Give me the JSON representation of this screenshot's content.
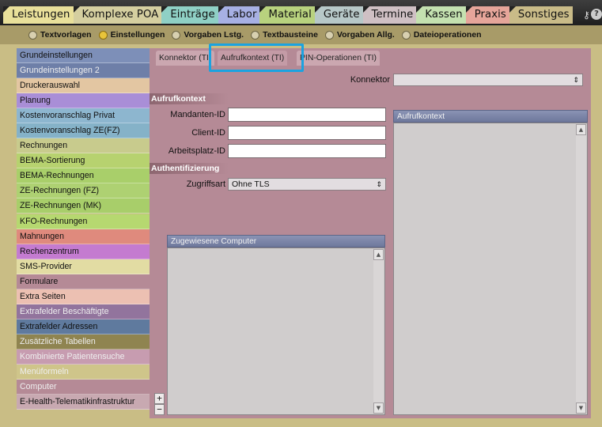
{
  "menu": {
    "items": [
      {
        "label": "Leistungen",
        "bg": "#e9e09a"
      },
      {
        "label": "Komplexe POA",
        "bg": "#d5cfa0"
      },
      {
        "label": "Einträge",
        "bg": "#8fd0c5"
      },
      {
        "label": "Labor",
        "bg": "#a7b0e4"
      },
      {
        "label": "Material",
        "bg": "#b8d27e"
      },
      {
        "label": "Geräte",
        "bg": "#b7c8c8"
      },
      {
        "label": "Termine",
        "bg": "#cfc0c4"
      },
      {
        "label": "Kassen",
        "bg": "#c4e1b0"
      },
      {
        "label": "Praxis",
        "bg": "#e6a59a"
      },
      {
        "label": "Sonstiges",
        "bg": "#c9bb88"
      }
    ],
    "tools": {
      "key_icon": "key-icon",
      "help_icon": "help-icon",
      "help_symbol": "?"
    }
  },
  "subbar": {
    "options": [
      {
        "label": "Textvorlagen",
        "selected": true
      },
      {
        "label": "Einstellungen",
        "selected": false,
        "radio_on": true
      },
      {
        "label": "Vorgaben Lstg.",
        "selected": false
      },
      {
        "label": "Textbausteine",
        "selected": false
      },
      {
        "label": "Vorgaben Allg.",
        "selected": false
      },
      {
        "label": "Dateioperationen",
        "selected": false
      }
    ]
  },
  "nav": {
    "items": [
      {
        "label": "Grundeinstellungen",
        "bg": "#7d8fb8",
        "light": false
      },
      {
        "label": "Grundeinstellungen 2",
        "bg": "#6e7fa8",
        "light": true
      },
      {
        "label": "Druckerauswahl",
        "bg": "#e3c6a2",
        "light": false
      },
      {
        "label": "Planung",
        "bg": "#a98ed7",
        "light": false
      },
      {
        "label": "Kostenvoranschlag Privat",
        "bg": "#8db6cf",
        "light": false
      },
      {
        "label": "Kostenvoranschlag ZE(FZ)",
        "bg": "#85b2c8",
        "light": false
      },
      {
        "label": "Rechnungen",
        "bg": "#c8cb8d",
        "light": false
      },
      {
        "label": "BEMA-Sortierung",
        "bg": "#b7d26f",
        "light": false
      },
      {
        "label": "BEMA-Rechnungen",
        "bg": "#a9cf6a",
        "light": false
      },
      {
        "label": "ZE-Rechnungen (FZ)",
        "bg": "#aed172",
        "light": false
      },
      {
        "label": "ZE-Rechnungen (MK)",
        "bg": "#a8ce6a",
        "light": false
      },
      {
        "label": "KFO-Rechnungen",
        "bg": "#b6d870",
        "light": false
      },
      {
        "label": "Mahnungen",
        "bg": "#df8a7d",
        "light": false
      },
      {
        "label": "Rechenzentrum",
        "bg": "#c47bd0",
        "light": false
      },
      {
        "label": "SMS-Provider",
        "bg": "#e2dca3",
        "light": false
      },
      {
        "label": "Formulare",
        "bg": "#b58a96",
        "light": false
      },
      {
        "label": "Extra Seiten",
        "bg": "#ecc0b2",
        "light": false
      },
      {
        "label": "Extrafelder Beschäftigte",
        "bg": "#92749d",
        "light": true
      },
      {
        "label": "Extrafelder Adressen",
        "bg": "#5f7a9e",
        "light": false
      },
      {
        "label": "Zusätzliche Tabellen",
        "bg": "#8f8450",
        "light": true
      },
      {
        "label": "Kombinierte Patientensuche",
        "bg": "#c79cb0",
        "light": true
      },
      {
        "label": "Menüformeln",
        "bg": "#cfc58a",
        "light": true
      },
      {
        "label": "Computer",
        "bg": "#b58a96",
        "light": true
      },
      {
        "label": "E-Health-Telematikinfrastruktur",
        "bg": "#c8a9b1",
        "light": false
      }
    ]
  },
  "tabs": [
    {
      "label": "Konnektor (TI)"
    },
    {
      "label": "Aufrufkontext (TI)"
    },
    {
      "label": "PIN-Operationen (TI)"
    }
  ],
  "form": {
    "konnektor_label": "Konnektor",
    "konnektor_value": "",
    "section_aufrufkontext": "Aufrufkontext",
    "mandanten_label": "Mandanten-ID",
    "mandanten_value": "",
    "client_label": "Client-ID",
    "client_value": "",
    "arbeitsplatz_label": "Arbeitsplatz-ID",
    "arbeitsplatz_value": "",
    "section_auth": "Authentifizierung",
    "zugriffsart_label": "Zugriffsart",
    "zugriffsart_value": "Ohne TLS"
  },
  "lists": {
    "computers_header": "Zugewiesene Computer",
    "context_header": "Aufrufkontext"
  },
  "buttons": {
    "add": "+",
    "remove": "−"
  },
  "colors": {
    "highlight": "#1ba3e0",
    "panel": "#b58a96",
    "main_bg": "#c9bd85",
    "subbar": "#a89b68"
  }
}
